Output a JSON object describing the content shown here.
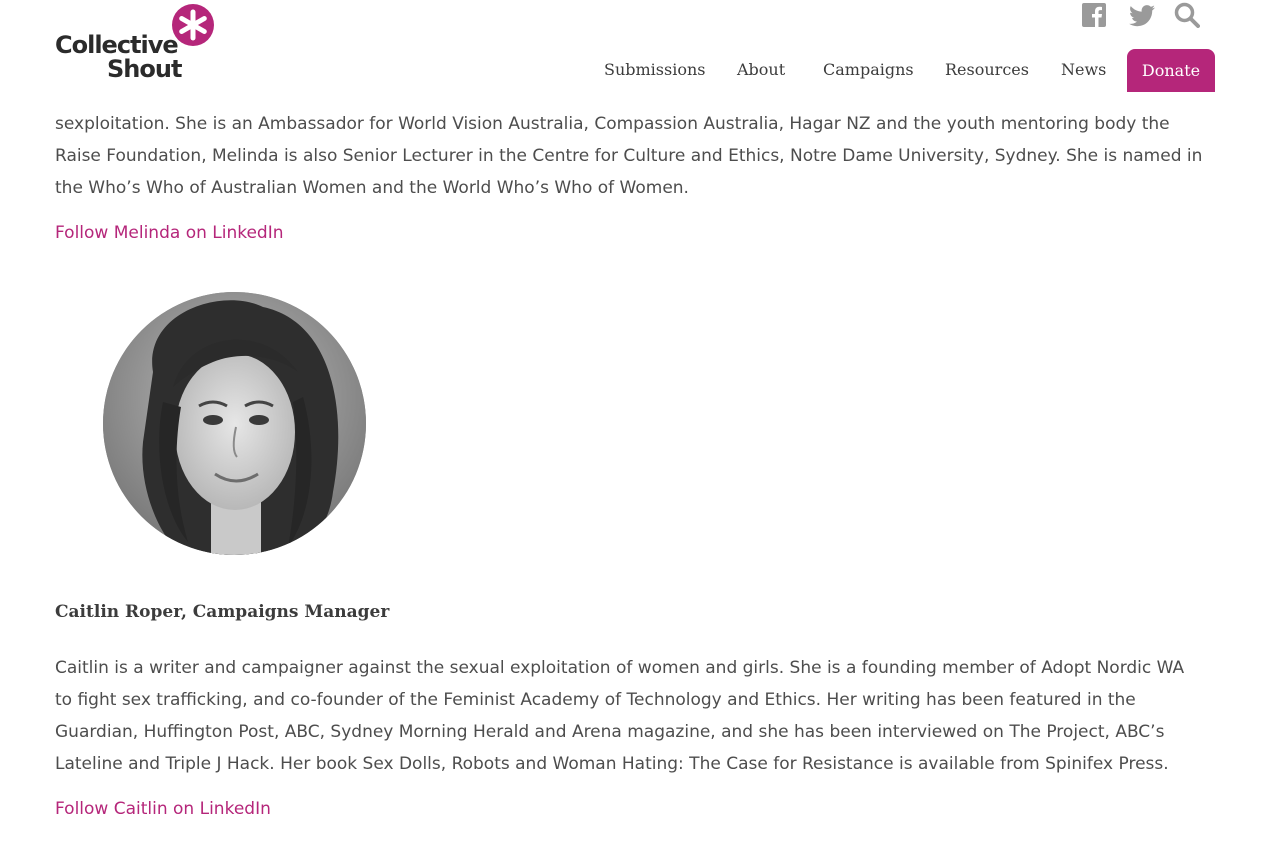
{
  "header": {
    "logo_line1": "Collective",
    "logo_line2": "Shout",
    "nav": [
      "Submissions",
      "About",
      "Campaigns",
      "Resources",
      "News"
    ],
    "donate_label": "Donate",
    "icons": [
      "facebook-icon",
      "twitter-icon",
      "search-icon"
    ],
    "accent_color": "#b5267a"
  },
  "melinda": {
    "bio_tail": "sexploitation. She is an Ambassador for World Vision Australia, Compassion Australia, Hagar NZ and the youth mentoring body the Raise Foundation, Melinda is also Senior Lecturer in the Centre for Culture and Ethics, Notre Dame University, Sydney. She is named in the Who’s Who of Australian Women and the World Who’s Who of Women.",
    "link_label": "Follow Melinda on LinkedIn"
  },
  "caitlin": {
    "heading": "Caitlin Roper, Campaigns Manager",
    "bio": "Caitlin is a writer and campaigner against the sexual exploitation of women and girls. She is a founding member of Adopt Nordic WA to fight sex trafficking, and co-founder of the Feminist Academy of Technology and Ethics. Her writing has been featured in the Guardian, Huffington Post, ABC, Sydney Morning Herald and Arena magazine, and she has been interviewed on The Project, ABC’s Lateline and Triple J Hack. Her book Sex Dolls, Robots and Woman Hating: The Case for Resistance is available from Spinifex Press.",
    "link_label": "Follow Caitlin on LinkedIn"
  }
}
